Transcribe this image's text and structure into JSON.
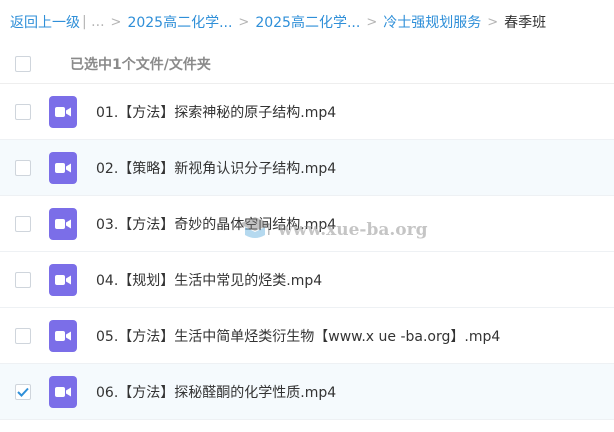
{
  "breadcrumb": {
    "back": "返回上一级",
    "ellipsis": "| ...",
    "seps": [
      ">",
      ">",
      ">",
      ">"
    ],
    "items": [
      "2025高二化学...",
      "2025高二化学...",
      "冷士强规划服务"
    ],
    "current": "春季班"
  },
  "list_header": {
    "selected_text": "已选中1个文件/文件夹"
  },
  "files": [
    {
      "name": "01.【方法】探索神秘的原子结构.mp4",
      "checked": false
    },
    {
      "name": "02.【策略】新视角认识分子结构.mp4",
      "checked": false
    },
    {
      "name": "03.【方法】奇妙的晶体空间结构.mp4",
      "checked": false
    },
    {
      "name": "04.【规划】生活中常见的烃类.mp4",
      "checked": false
    },
    {
      "name": "05.【方法】生活中简单烃类衍生物【www.x ue -ba.org】.mp4",
      "checked": false
    },
    {
      "name": "06.【方法】探秘醛酮的化学性质.mp4",
      "checked": true
    }
  ],
  "watermark": {
    "text": "www.xue-ba.org"
  },
  "colors": {
    "link": "#2f8fd8",
    "video_icon": "#7b6ee8",
    "row_alt": "#f5fafd",
    "check": "#2f8fd8"
  }
}
